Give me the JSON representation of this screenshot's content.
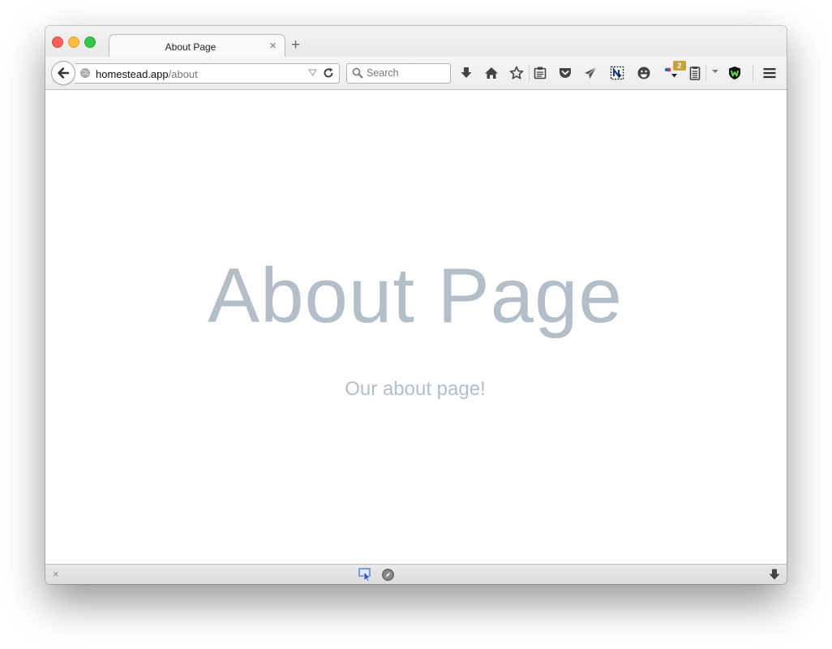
{
  "browser": {
    "tab": {
      "title": "About Page",
      "close_glyph": "×"
    },
    "new_tab_glyph": "+",
    "url": {
      "host": "homestead.app",
      "path": "/about"
    },
    "search": {
      "placeholder": "Search"
    },
    "badge_count": "2",
    "toolbar_icons": [
      "download-icon",
      "home-icon",
      "bookmark-star-icon",
      "clipboard-icon",
      "pocket-icon",
      "send-icon",
      "newsblur-icon",
      "smiley-icon",
      "colorful-dots-icon",
      "notes-icon",
      "extension-w-icon",
      "hamburger-menu-icon"
    ],
    "status_bar": {
      "close_glyph": "×"
    }
  },
  "page": {
    "title": "About Page",
    "subtitle": "Our about page!"
  },
  "colors": {
    "accent_text": "#b3bec8",
    "close": "#fc605c",
    "minimize": "#fdbc40",
    "maximize": "#34c84a",
    "badge": "#c6a23a",
    "w_icon_green": "#6de04a"
  }
}
